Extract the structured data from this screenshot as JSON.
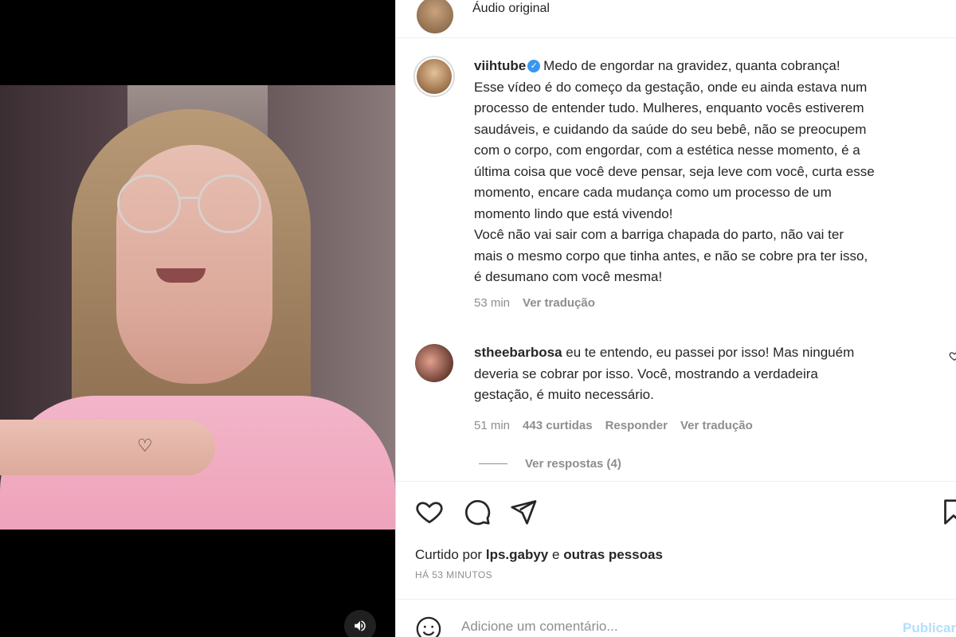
{
  "header": {
    "audio_label": "Áudio original"
  },
  "post": {
    "username": "viihtube",
    "verified": true,
    "caption_lines": [
      "Medo de engordar na gravidez, quanta cobrança!",
      "Esse vídeo é do começo da gestação, onde eu ainda estava num",
      "processo de entender tudo. Mulheres, enquanto vocês estiverem",
      "saudáveis, e cuidando da saúde do seu bebê, não se preocupem",
      "com o corpo, com engordar, com a estética nesse momento, é a",
      "última coisa que você deve pensar, seja leve com você, curta esse",
      "momento, encare cada mudança como um processo de um",
      "momento lindo que está vivendo!",
      "Você não vai sair com a barriga chapada do parto, não vai ter",
      "mais o mesmo corpo que tinha antes, e não se cobre pra ter isso,",
      "é desumano com você mesma!"
    ],
    "time": "53 min",
    "translate_label": "Ver tradução"
  },
  "comment": {
    "username": "stheebarbosa",
    "text_lines": [
      "eu te entendo, eu passei por isso! Mas ninguém",
      "deveria se cobrar por isso. Você, mostrando a verdadeira",
      "gestação, é muito necessário."
    ],
    "time": "51 min",
    "likes": "443 curtidas",
    "reply_label": "Responder",
    "translate_label": "Ver tradução",
    "view_replies": "Ver respostas (4)"
  },
  "actions": {
    "liked_by_prefix": "Curtido por",
    "liked_by_user": "lps.gabyy",
    "liked_by_conj": "e",
    "liked_by_others": "outras pessoas",
    "time_ago": "HÁ 53 MINUTOS"
  },
  "add_comment": {
    "placeholder": "Adicione um comentário...",
    "publish_label": "Publicar"
  },
  "icons": {
    "like": "heart-icon",
    "comment": "comment-icon",
    "share": "paper-plane-icon",
    "save": "bookmark-icon",
    "sound": "speaker-icon",
    "emoji": "emoji-icon"
  },
  "colors": {
    "accent": "#3897f0",
    "publish_disabled": "#b2dffc",
    "secondary_text": "#8e8e8e"
  }
}
